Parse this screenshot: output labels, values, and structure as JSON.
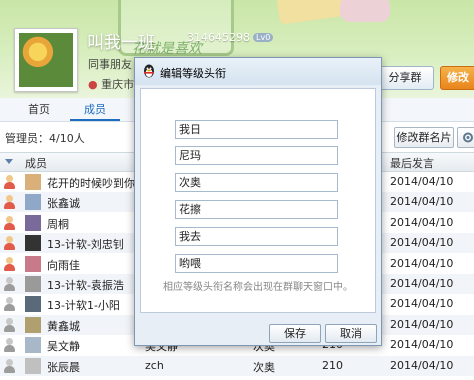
{
  "header": {
    "group_name": "叫我一班",
    "group_id": "314645298",
    "level_badge": "Lv0",
    "category": "同事朋友",
    "location": "重庆市重",
    "share_button": "分享群",
    "edit_button": "修改",
    "banner_text": "花就是喜欢"
  },
  "tabs": [
    {
      "label": "首页",
      "active": false
    },
    {
      "label": "成员",
      "active": true
    }
  ],
  "admin_info": "管理员：4/10人",
  "edit_card_button": "修改群名片",
  "table": {
    "col_member": "成员",
    "col_last_speak": "最后发言",
    "rows": [
      {
        "name": "花开的时候吵到你...",
        "card": "",
        "title": "",
        "points": "",
        "date": "2014/04/10",
        "online": true
      },
      {
        "name": "张鑫诚",
        "card": "",
        "title": "",
        "points": "",
        "date": "2014/04/10",
        "online": true
      },
      {
        "name": "周桐",
        "card": "",
        "title": "",
        "points": "",
        "date": "2014/04/10",
        "online": true
      },
      {
        "name": "13-计软-刘忠钊",
        "card": "",
        "title": "",
        "points": "",
        "date": "2014/04/10",
        "online": true
      },
      {
        "name": "向雨佳",
        "card": "",
        "title": "",
        "points": "",
        "date": "2014/04/10",
        "online": true
      },
      {
        "name": "13-计软-袁振浩",
        "card": "",
        "title": "",
        "points": "",
        "date": "2014/04/10",
        "online": false
      },
      {
        "name": "13-计软1-小阳",
        "card": "",
        "title": "",
        "points": "",
        "date": "2014/04/10",
        "online": false
      },
      {
        "name": "黄鑫城",
        "card": "",
        "title": "",
        "points": "",
        "date": "2014/04/10",
        "online": false
      },
      {
        "name": "吴文静",
        "card": "吴文静",
        "title": "次奥",
        "points": "210",
        "date": "2014/04/10",
        "online": false
      },
      {
        "name": "张辰晨",
        "card": "zch",
        "title": "次奥",
        "points": "210",
        "date": "2014/04/10",
        "online": false
      }
    ]
  },
  "dialog": {
    "title": "编辑等级头衔",
    "levels": [
      "我日",
      "尼玛",
      "次奥",
      "花擦",
      "我去",
      "哟喂"
    ],
    "hint": "相应等级头衔名称会出现在群聊天窗口中。",
    "save_button": "保存",
    "cancel_button": "取消"
  }
}
